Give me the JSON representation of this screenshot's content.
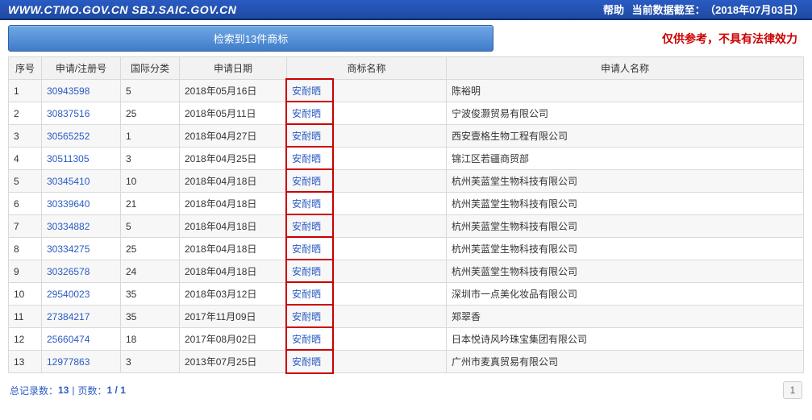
{
  "topbar": {
    "url": "WWW.CTMO.GOV.CN SBJ.SAIC.GOV.CN",
    "help": "帮助",
    "dataAsOfLabel": "当前数据截至：",
    "dataAsOf": "（2018年07月03日）"
  },
  "summary": {
    "bluebtn": "检索到13件商标",
    "redtext": "仅供参考，不具有法律效力"
  },
  "table": {
    "headers": {
      "idx": "序号",
      "appNo": "申请/注册号",
      "cls": "国际分类",
      "date": "申请日期",
      "tmName": "商标名称",
      "applicant": "申请人名称"
    },
    "rows": [
      {
        "idx": "1",
        "appNo": "30943598",
        "cls": "5",
        "date": "2018年05月16日",
        "tmName": "安耐晒",
        "applicant": "陈裕明"
      },
      {
        "idx": "2",
        "appNo": "30837516",
        "cls": "25",
        "date": "2018年05月11日",
        "tmName": "安耐晒",
        "applicant": "宁波俊灏贸易有限公司"
      },
      {
        "idx": "3",
        "appNo": "30565252",
        "cls": "1",
        "date": "2018年04月27日",
        "tmName": "安耐晒",
        "applicant": "西安壹格生物工程有限公司"
      },
      {
        "idx": "4",
        "appNo": "30511305",
        "cls": "3",
        "date": "2018年04月25日",
        "tmName": "安耐晒",
        "applicant": "锦江区若疆商贸部"
      },
      {
        "idx": "5",
        "appNo": "30345410",
        "cls": "10",
        "date": "2018年04月18日",
        "tmName": "安耐晒",
        "applicant": "杭州芙蓝堂生物科技有限公司"
      },
      {
        "idx": "6",
        "appNo": "30339640",
        "cls": "21",
        "date": "2018年04月18日",
        "tmName": "安耐晒",
        "applicant": "杭州芙蓝堂生物科技有限公司"
      },
      {
        "idx": "7",
        "appNo": "30334882",
        "cls": "5",
        "date": "2018年04月18日",
        "tmName": "安耐晒",
        "applicant": "杭州芙蓝堂生物科技有限公司"
      },
      {
        "idx": "8",
        "appNo": "30334275",
        "cls": "25",
        "date": "2018年04月18日",
        "tmName": "安耐晒",
        "applicant": "杭州芙蓝堂生物科技有限公司"
      },
      {
        "idx": "9",
        "appNo": "30326578",
        "cls": "24",
        "date": "2018年04月18日",
        "tmName": "安耐晒",
        "applicant": "杭州芙蓝堂生物科技有限公司"
      },
      {
        "idx": "10",
        "appNo": "29540023",
        "cls": "35",
        "date": "2018年03月12日",
        "tmName": "安耐晒",
        "applicant": "深圳市一点美化妆品有限公司"
      },
      {
        "idx": "11",
        "appNo": "27384217",
        "cls": "35",
        "date": "2017年11月09日",
        "tmName": "安耐晒",
        "applicant": "郑翠香"
      },
      {
        "idx": "12",
        "appNo": "25660474",
        "cls": "18",
        "date": "2017年08月02日",
        "tmName": "安耐晒",
        "applicant": "日本悦诗风吟珠宝集团有限公司"
      },
      {
        "idx": "13",
        "appNo": "12977863",
        "cls": "3",
        "date": "2013年07月25日",
        "tmName": "安耐晒",
        "applicant": "广州市麦真贸易有限公司"
      }
    ]
  },
  "footer": {
    "totalLabel": "总记录数：",
    "total": "13",
    "pagesLabel": "页数：",
    "pages": "1 / 1",
    "currentPage": "1"
  }
}
